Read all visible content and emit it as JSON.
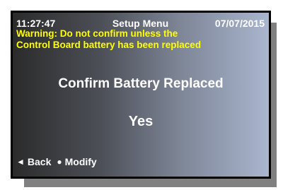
{
  "header": {
    "time": "11:27:47",
    "title": "Setup Menu",
    "date": "07/07/2015"
  },
  "warning": {
    "line1": "Warning: Do not confirm unless the",
    "line2": "Control Board battery has been replaced",
    "color": "#ffff00"
  },
  "main": {
    "prompt": "Confirm Battery Replaced",
    "value": "Yes"
  },
  "footer": {
    "back_glyph": "◄",
    "back_label": "Back",
    "modify_glyph": "●",
    "modify_label": "Modify"
  }
}
